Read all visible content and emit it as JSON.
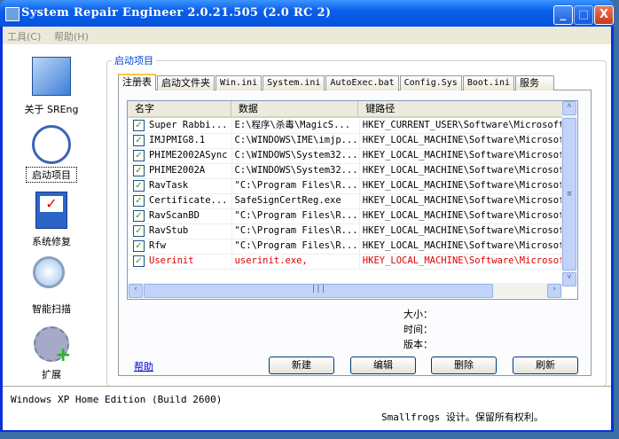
{
  "window": {
    "title": "System Repair Engineer 2.0.21.505 (2.0 RC 2)",
    "minimize": "_",
    "maximize": "□",
    "close": "X"
  },
  "menu": [
    "工具(C)",
    "帮助(H)"
  ],
  "nav": [
    {
      "label": "关于 SREng",
      "icon": "tools-icon"
    },
    {
      "label": "启动项目",
      "icon": "clock-icon"
    },
    {
      "label": "系统修复",
      "icon": "checklist-icon"
    },
    {
      "label": "智能扫描",
      "icon": "magnifier-icon"
    },
    {
      "label": "扩展",
      "icon": "gear-plus-icon"
    }
  ],
  "group_title": "启动项目",
  "tabs": [
    "注册表",
    "启动文件夹",
    "Win.ini",
    "System.ini",
    "AutoExec.bat",
    "Config.Sys",
    "Boot.ini",
    "服务"
  ],
  "columns": [
    "名字",
    "数据",
    "键路径"
  ],
  "rows": [
    {
      "name": "Super Rabbi...",
      "data": "E:\\程序\\杀毒\\MagicS...",
      "path": "HKEY_CURRENT_USER\\Software\\Microsoft\\W",
      "checked": true
    },
    {
      "name": "IMJPMIG8.1",
      "data": "C:\\WINDOWS\\IME\\imjp...",
      "path": "HKEY_LOCAL_MACHINE\\Software\\Microsoft",
      "checked": true
    },
    {
      "name": "PHIME2002ASync",
      "data": "C:\\WINDOWS\\System32...",
      "path": "HKEY_LOCAL_MACHINE\\Software\\Microsoft",
      "checked": true
    },
    {
      "name": "PHIME2002A",
      "data": "C:\\WINDOWS\\System32...",
      "path": "HKEY_LOCAL_MACHINE\\Software\\Microsoft",
      "checked": true
    },
    {
      "name": "RavTask",
      "data": "\"C:\\Program Files\\R...",
      "path": "HKEY_LOCAL_MACHINE\\Software\\Microsoft",
      "checked": true
    },
    {
      "name": "Certificate...",
      "data": "SafeSignCertReg.exe",
      "path": "HKEY_LOCAL_MACHINE\\Software\\Microsoft",
      "checked": true
    },
    {
      "name": "RavScanBD",
      "data": "\"C:\\Program Files\\R...",
      "path": "HKEY_LOCAL_MACHINE\\Software\\Microsoft",
      "checked": true
    },
    {
      "name": "RavStub",
      "data": "\"C:\\Program Files\\R...",
      "path": "HKEY_LOCAL_MACHINE\\Software\\Microsoft",
      "checked": true
    },
    {
      "name": "Rfw",
      "data": "\"C:\\Program Files\\R...",
      "path": "HKEY_LOCAL_MACHINE\\Software\\Microsoft",
      "checked": true
    },
    {
      "name": "Userinit",
      "data": "userinit.exe,",
      "path": "HKEY_LOCAL_MACHINE\\Software\\Microsoft",
      "checked": true,
      "highlight": true
    }
  ],
  "info": {
    "size": "大小：",
    "time": "时间：",
    "version": "版本："
  },
  "help_link": "帮助",
  "buttons": {
    "new": "新建",
    "edit": "编辑",
    "delete": "删除",
    "refresh": "刷新"
  },
  "status": {
    "os": "Windows XP Home Edition  (Build 2600)",
    "copyright": "Smallfrogs 设计。保留所有权利。"
  }
}
